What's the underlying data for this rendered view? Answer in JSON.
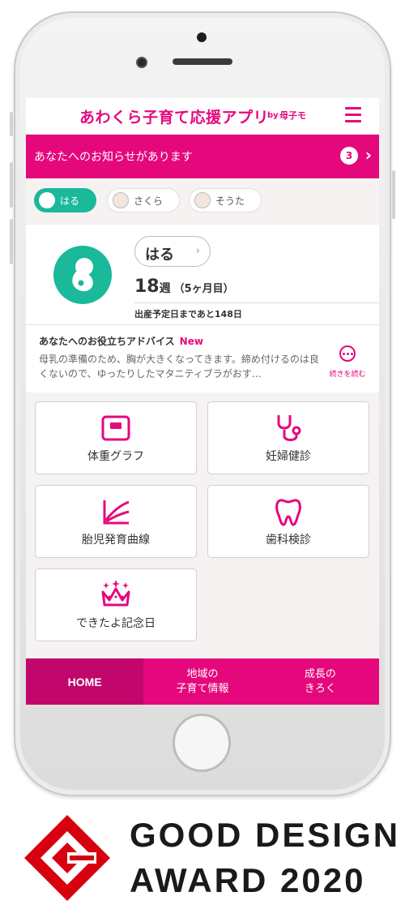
{
  "app": {
    "title": "あわくら子育て応援アプリ",
    "by": "by",
    "brand": "母子モ"
  },
  "notice": {
    "text": "あなたへのお知らせがあります",
    "count": "3"
  },
  "kids": [
    {
      "label": "はる",
      "active": true
    },
    {
      "label": "さくら",
      "active": false
    },
    {
      "label": "そうた",
      "active": false
    }
  ],
  "profile": {
    "name": "はる",
    "weeks": "18",
    "weeks_unit": "週",
    "months": "（5ヶ月目）",
    "due_text": "出産予定日まであと148日"
  },
  "advice": {
    "title": "あなたへのお役立ちアドバイス",
    "badge": "New",
    "body": "母乳の準備のため、胸が大きくなってきます。締め付けるのは良くないので、ゆったりしたマタニティブラがおす…",
    "more_label": "続きを読む"
  },
  "menu": [
    {
      "label": "体重グラフ",
      "icon": "scale-icon"
    },
    {
      "label": "妊婦健診",
      "icon": "stethoscope-icon"
    },
    {
      "label": "胎児発育曲線",
      "icon": "growth-curve-icon"
    },
    {
      "label": "歯科検診",
      "icon": "tooth-icon"
    },
    {
      "label": "できたよ記念日",
      "icon": "crown-icon"
    }
  ],
  "nav": [
    {
      "label": "HOME",
      "active": true
    },
    {
      "label": "地域の\n子育て情報",
      "active": false
    },
    {
      "label": "成長の\nきろく",
      "active": false
    }
  ],
  "award": {
    "line1": "GOOD DESIGN",
    "line2": "AWARD 2020"
  },
  "colors": {
    "accent": "#e5087d",
    "teal": "#19b99a",
    "award_red": "#d7000f"
  }
}
